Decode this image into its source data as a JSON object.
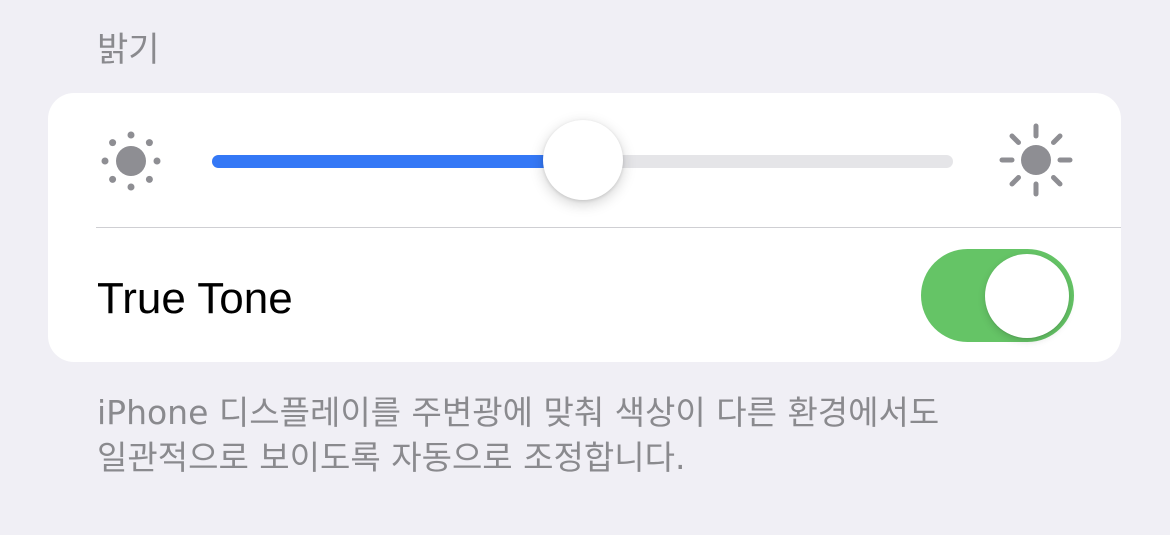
{
  "section": {
    "header": "밝기"
  },
  "brightness": {
    "min_icon": "sun-dim-icon",
    "max_icon": "sun-bright-icon",
    "level": 0.5,
    "fill_color": "#3478f6",
    "track_color": "#e5e5e8"
  },
  "true_tone": {
    "label": "True Tone",
    "enabled": true,
    "on_color": "#65c466"
  },
  "footer": {
    "line1": "iPhone 디스플레이를 주변광에 맞춰 색상이 다른 환경에서도",
    "line2": "일관적으로 보이도록 자동으로 조정합니다."
  }
}
